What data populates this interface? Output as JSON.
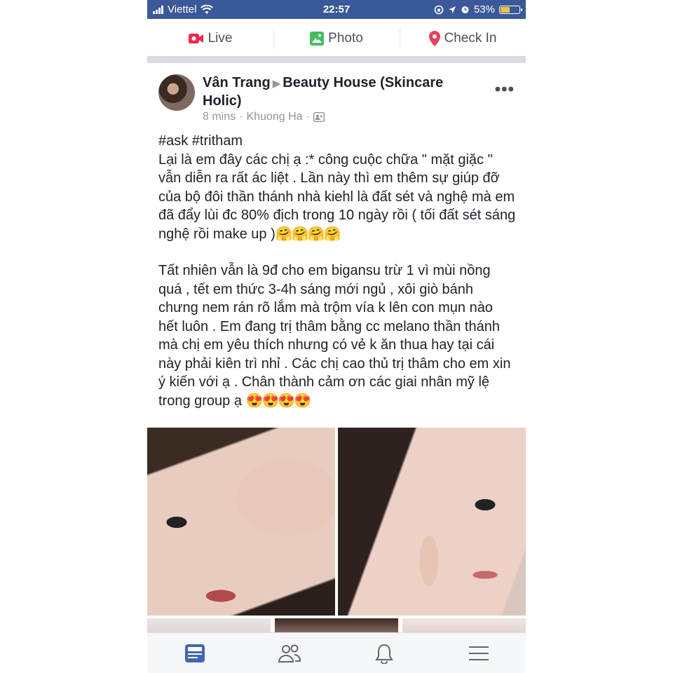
{
  "status_bar": {
    "carrier": "Viettel",
    "time": "22:57",
    "battery": "53%",
    "battery_level": 0.53,
    "battery_color": "#f5c242",
    "background": "#3b5998"
  },
  "composer": {
    "live_label": "Live",
    "photo_label": "Photo",
    "checkin_label": "Check In"
  },
  "post": {
    "author": "Vân Trang",
    "group": "Beauty House (Skincare Holic)",
    "time": "8 mins",
    "location": "Khuong Ha",
    "hashtags": "#ask #tritham",
    "line1": "Lại là em đây các chị ạ :* công cuộc chữa \" mặt giặc \" vẫn diễn ra rất ác liệt . Lần này thì em thêm sự giúp đỡ của bộ đôi thần thánh nhà kiehl là đất sét và nghệ mà em đã đẩy lùi đc 80% địch trong 10 ngày rồi ( tối đất sét sáng nghệ  rồi make up )",
    "emoji1": "🤗🤗🤗🤗",
    "line2": "Tất nhiên vẫn là 9đ cho em bigansu trừ 1 vì mùi nồng quá , tết em thức 3-4h sáng mới ngủ , xôi giò bánh chưng nem rán rõ lắm mà trộm vía k lên con mụn nào hết luôn . Em đang trị thâm bằng cc melano thần thánh mà chị em yêu thích nhưng có vẻ k ăn thua hay tại cái này phải kiên trì nhỉ . Các chị cao thủ trị thâm cho em xin ý kiến với ạ . Chân thành cảm ơn các giai nhân mỹ lệ trong group ạ",
    "emoji2": "😍😍😍😍"
  },
  "icons": {
    "live": "video-camera-icon",
    "photo": "photo-icon",
    "checkin": "location-pin-icon",
    "more": "more-options-icon",
    "privacy": "group-members-icon",
    "tab_feed": "news-feed-icon",
    "tab_friends": "friends-icon",
    "tab_notifications": "bell-icon",
    "tab_menu": "menu-icon"
  },
  "colors": {
    "brand": "#3b5998",
    "live": "#f02849",
    "photo": "#45bd62",
    "checkin": "#e4405f",
    "tab_active": "#4267b2"
  }
}
